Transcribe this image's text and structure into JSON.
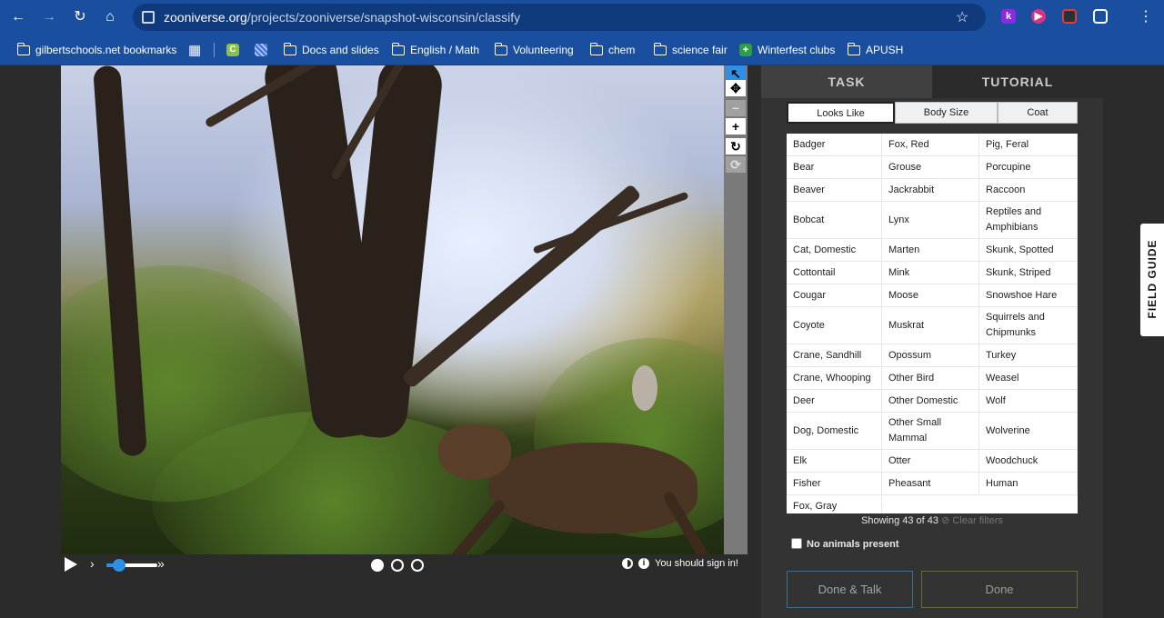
{
  "browser": {
    "url_host": "zooniverse.org",
    "url_path": "/projects/zooniverse/snapshot-wisconsin/classify",
    "extensions": [
      "k-extension-icon",
      "video-extension-icon",
      "puzzle-extension-icon"
    ],
    "bookmarks": [
      {
        "label": "gilbertschools.net bookmarks",
        "icon": "managed-bookmarks-icon"
      },
      {
        "label": "",
        "icon": "apps-grid-icon"
      },
      {
        "label": "",
        "icon": "c-app-icon"
      },
      {
        "label": "",
        "icon": "striped-app-icon"
      },
      {
        "label": "Docs and slides",
        "icon": "folder-icon"
      },
      {
        "label": "English / Math",
        "icon": "folder-icon"
      },
      {
        "label": "Volunteering",
        "icon": "folder-icon"
      },
      {
        "label": "chem",
        "icon": "folder-icon"
      },
      {
        "label": "science fair",
        "icon": "folder-icon"
      },
      {
        "label": "Winterfest clubs",
        "icon": "green-plus-icon"
      },
      {
        "label": "APUSH",
        "icon": "folder-icon"
      }
    ]
  },
  "viewer": {
    "tools": [
      "pointer-icon",
      "move-icon",
      "zoom-out-icon",
      "zoom-in-icon",
      "rotate-icon",
      "reset-icon"
    ],
    "signin_text": "You should sign in!",
    "frame_count": 3,
    "active_frame": 1,
    "playback_speed": 0.25
  },
  "task": {
    "tab_task": "TASK",
    "tab_tutorial": "TUTORIAL",
    "filters": [
      "Looks Like",
      "Body Size",
      "Coat"
    ],
    "choices_col1": [
      "Badger",
      "Bear",
      "Beaver",
      "Bobcat",
      "Cat, Domestic",
      "Cottontail",
      "Cougar",
      "Coyote",
      "Crane, Sandhill",
      "Crane, Whooping",
      "Deer",
      "Dog, Domestic",
      "Elk",
      "Fisher",
      "Fox, Gray"
    ],
    "choices_col2": [
      "Fox, Red",
      "Grouse",
      "Jackrabbit",
      "Lynx",
      "Marten",
      "Mink",
      "Moose",
      "Muskrat",
      "Opossum",
      "Other Bird",
      "Other Domestic",
      "Other Small Mammal",
      "Otter",
      "Pheasant"
    ],
    "choices_col3": [
      "Pig, Feral",
      "Porcupine",
      "Raccoon",
      "Reptiles and Amphibians",
      "Skunk, Spotted",
      "Skunk, Striped",
      "Snowshoe Hare",
      "Squirrels and Chipmunks",
      "Turkey",
      "Weasel",
      "Wolf",
      "Wolverine",
      "Woodchuck",
      "Human"
    ],
    "showing": "Showing 43 of 43",
    "clear_filters": "Clear filters",
    "no_animals": "No animals present",
    "done_talk": "Done & Talk",
    "done": "Done",
    "field_guide": "FIELD GUIDE"
  }
}
